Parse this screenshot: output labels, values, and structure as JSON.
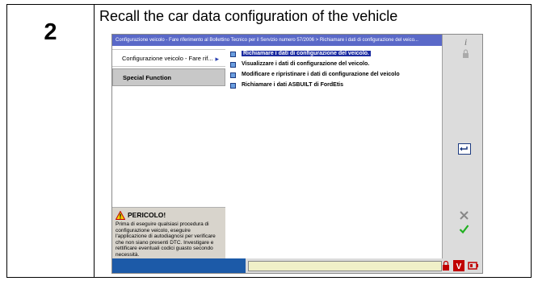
{
  "step": {
    "number": "2",
    "title": "Recall the car data configuration of the vehicle"
  },
  "app": {
    "title_bar": "Configurazione veicolo - Fare riferimento al Bollettino Tecnico per il Servizio numero 57/2006 > Richiamare i dati di configurazione del veico...",
    "tabs": [
      {
        "label": "Configurazione veicolo - Fare rif..."
      },
      {
        "label": "Special Function"
      }
    ],
    "menu": [
      {
        "label": "Richiamare i dati di configurazione del veicolo.",
        "selected": true
      },
      {
        "label": "Visualizzare i dati di configurazione del veicolo.",
        "selected": false
      },
      {
        "label": "Modificare e ripristinare i dati di configurazione del veicolo",
        "selected": false
      },
      {
        "label": "Richiamare i dati ASBUILT di FordEtis",
        "selected": false
      }
    ],
    "warning": {
      "title": "PERICOLO!",
      "body": "Prima di eseguire qualsiasi procedura di configurazione veicolo, eseguire l'applicazione di autodiagnosi per verificare che non siano presenti DTC. Investigare e rettificare eventuali codici guasto secondo necessità."
    },
    "icons": [
      "info-icon",
      "lock-icon",
      "back-icon",
      "cancel-icon",
      "confirm-icon",
      "lock-status-icon",
      "vehicle-status-icon",
      "battery-icon"
    ],
    "colors": {
      "title_bar": "#5a69c8",
      "selected_item": "#1a2aa0",
      "status_blue": "#1c5aa8"
    }
  }
}
